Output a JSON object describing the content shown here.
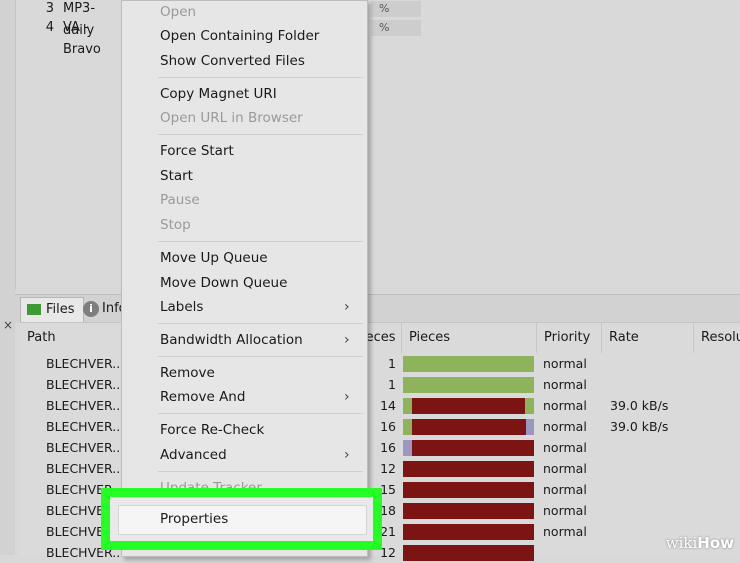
{
  "torrents": [
    {
      "num": "3",
      "name": "MP3-daily"
    },
    {
      "num": "4",
      "name": "VA - Bravo"
    }
  ],
  "tabs": {
    "files": "Files",
    "info": "Info"
  },
  "close_glyph": "×",
  "table": {
    "headers": {
      "path": "Path",
      "pieces_count": "ieces",
      "pieces": "Pieces",
      "priority": "Priority",
      "rate": "Rate",
      "resolution": "Resolu"
    },
    "rows": [
      {
        "path": "BLECHVER...",
        "pieces": "1",
        "priority": "normal",
        "rate": ""
      },
      {
        "path": "BLECHVER...",
        "pieces": "1",
        "priority": "normal",
        "rate": ""
      },
      {
        "path": "BLECHVER...",
        "pieces": "14",
        "priority": "normal",
        "rate": "39.0 kB/s"
      },
      {
        "path": "BLECHVER...",
        "pieces": "16",
        "priority": "normal",
        "rate": "39.0 kB/s"
      },
      {
        "path": "BLECHVER...",
        "pieces": "16",
        "priority": "normal",
        "rate": ""
      },
      {
        "path": "BLECHVER...",
        "pieces": "12",
        "priority": "normal",
        "rate": ""
      },
      {
        "path": "BLECHVER...",
        "pieces": "15",
        "priority": "normal",
        "rate": ""
      },
      {
        "path": "BLECHVER...",
        "pieces": "18",
        "priority": "normal",
        "rate": ""
      },
      {
        "path": "BLECHVER...",
        "pieces": "21",
        "priority": "normal",
        "rate": ""
      },
      {
        "path": "BLECHVER...",
        "pieces": "12",
        "priority": "",
        "rate": ""
      }
    ]
  },
  "context_menu": {
    "open": "Open",
    "open_containing_folder": "Open Containing Folder",
    "show_converted_files": "Show Converted Files",
    "copy_magnet_uri": "Copy Magnet URI",
    "open_url_in_browser": "Open URL in Browser",
    "force_start": "Force Start",
    "start": "Start",
    "pause": "Pause",
    "stop": "Stop",
    "move_up_queue": "Move Up Queue",
    "move_down_queue": "Move Down Queue",
    "labels": "Labels",
    "bandwidth_allocation": "Bandwidth Allocation",
    "remove": "Remove",
    "remove_and": "Remove And",
    "force_recheck": "Force Re-Check",
    "advanced": "Advanced",
    "update_tracker": "Update Tracker",
    "properties": "Properties",
    "submenu_arrow": "›"
  },
  "colors": {
    "highlight": "#23ff23",
    "piece_done": "#8db35d",
    "piece_missing": "#7d1414",
    "piece_partial": "#9a97c2"
  },
  "watermark": {
    "wiki": "wiki",
    "how": "How"
  }
}
